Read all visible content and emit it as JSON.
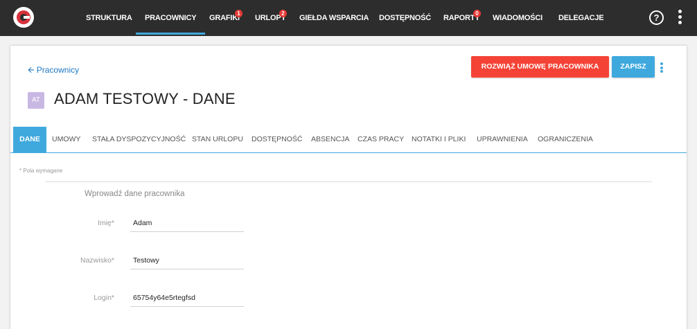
{
  "nav": {
    "items": [
      {
        "label": "STRUKTURA",
        "badge": null
      },
      {
        "label": "PRACOWNICY",
        "badge": null,
        "active": true
      },
      {
        "label": "GRAFIKI",
        "badge": "1"
      },
      {
        "label": "URLOPY",
        "badge": "2"
      },
      {
        "label": "GIEŁDA WSPARCIA",
        "badge": null
      },
      {
        "label": "DOSTĘPNOŚĆ",
        "badge": null
      },
      {
        "label": "RAPORTY",
        "badge": "0"
      },
      {
        "label": "WIADOMOŚCI",
        "badge": null
      },
      {
        "label": "DELEGACJE",
        "badge": null
      }
    ],
    "help_label": "?"
  },
  "header": {
    "back_label": "Pracownicy",
    "terminate_button": "ROZWIĄŻ UMOWĘ PRACOWNIKA",
    "save_button": "ZAPISZ",
    "avatar_initials": "AT",
    "title": "ADAM TESTOWY - DANE"
  },
  "tabs": [
    {
      "label": "DANE",
      "active": true
    },
    {
      "label": "UMOWY"
    },
    {
      "label": "STAŁA DYSPOZYCYJNOŚĆ"
    },
    {
      "label": "STAN URLOPU"
    },
    {
      "label": "DOSTĘPNOŚĆ"
    },
    {
      "label": "ABSENCJA"
    },
    {
      "label": "CZAS PRACY"
    },
    {
      "label": "NOTATKI I PLIKI"
    },
    {
      "label": "UPRAWNIENIA"
    },
    {
      "label": "OGRANICZENIA"
    }
  ],
  "form": {
    "required_note": "* Pola wymagane",
    "section_title": "Wprowadź dane pracownika",
    "fields": [
      {
        "label": "Imię*",
        "value": "Adam"
      },
      {
        "label": "Nazwisko*",
        "value": "Testowy"
      },
      {
        "label": "Login*",
        "value": "65754y64e5rtegfsd"
      }
    ]
  },
  "colors": {
    "nav_bg": "#2d2d2d",
    "accent": "#3fa9de",
    "danger": "#f44336",
    "badge": "#e53935",
    "avatar": "#c9b7e3"
  }
}
